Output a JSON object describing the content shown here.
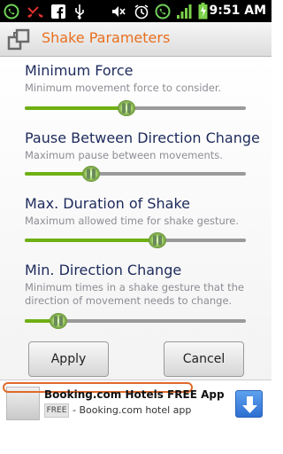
{
  "status_bar": {
    "time": "9:51 AM",
    "icons": [
      "whatsapp-icon",
      "missed-call-icon",
      "facebook-icon",
      "usb-icon",
      "mute-icon",
      "alarm-icon",
      "whatsapp-icon",
      "signal-icon",
      "battery-charging-icon"
    ]
  },
  "header": {
    "title": "Shake Parameters",
    "icon": "settings-app-icon"
  },
  "preferences": [
    {
      "title": "Minimum Force",
      "summary": "Minimum movement force to consider.",
      "slider_fraction": 0.46
    },
    {
      "title": "Pause Between Direction Change",
      "summary": "Maximum pause between movements.",
      "slider_fraction": 0.3
    },
    {
      "title": "Max. Duration of Shake",
      "summary": "Maximum allowed time for shake gesture.",
      "slider_fraction": 0.6
    },
    {
      "title": "Min. Direction Change",
      "summary": "Minimum times in a shake gesture that the direction of movement needs to change.",
      "slider_fraction": 0.15
    }
  ],
  "buttons": {
    "apply": "Apply",
    "cancel": "Cancel"
  },
  "ad": {
    "title": "Booking.com Hotels FREE App",
    "badge": "FREE",
    "subtitle": "- Booking.com hotel app",
    "download_icon": "download-arrow-icon"
  },
  "colors": {
    "accent": "#e8701f",
    "slider_fill": "#6fb013",
    "title_text": "#1d2a5c"
  }
}
